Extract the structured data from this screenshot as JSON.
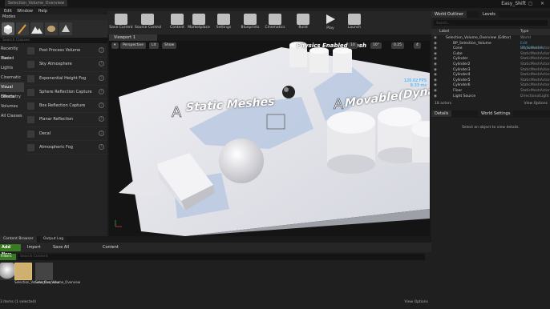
{
  "window": {
    "tab_title": "Selection_Volume_Overview",
    "project_name": "Easy_Shift",
    "controls": "– ◻ ✕"
  },
  "menu": [
    "Edit",
    "Window",
    "Help"
  ],
  "modes_tab": "Modes",
  "left_panel": {
    "search_placeholder": "Search Classes",
    "categories": [
      "Recently Placed",
      "Basic",
      "Lights",
      "Cinematic",
      "Visual Effects",
      "Geometry",
      "Volumes",
      "All Classes"
    ],
    "selected_category": "Visual Effects",
    "items": [
      "Post Process Volume",
      "Sky Atmosphere",
      "Exponential Height Fog",
      "Sphere Reflection Capture",
      "Box Reflection Capture",
      "Planar Reflection",
      "Decal",
      "Atmospheric Fog"
    ]
  },
  "toolbar": {
    "buttons": [
      "Save Current",
      "Source Control",
      "Content",
      "Marketplace",
      "Settings",
      "Blueprints",
      "Cinematics",
      "Build",
      "Play",
      "Launch"
    ]
  },
  "viewport": {
    "tab": "Viewport 1",
    "perspective": "Perspective",
    "lit": "Lit",
    "show": "Show",
    "grid": "10",
    "angle": "10°",
    "scale": "0.25",
    "camera": "4",
    "fps": "120.02 FPS",
    "ms": "8.33 ms",
    "labels": [
      "Static Meshes",
      "Movable(Dynamic)",
      "Physics Enabled Meshes"
    ],
    "label_display": [
      "Static Meshes",
      "Movable(Dynamic)",
      "Physics Enabled Mesh"
    ],
    "letter": "A"
  },
  "content_browser": {
    "tabs": [
      "Content Browser",
      "Output Log"
    ],
    "add_new": "Add New",
    "import": "Import",
    "save_all": "Save All",
    "path": "Content",
    "filters": "Filters",
    "search_placeholder": "Search Content",
    "assets": [
      {
        "name": "",
        "kind": "sphere"
      },
      {
        "name": "Selection_Volume_Overview",
        "kind": "map"
      },
      {
        "name": "Selection_Volume_Overview",
        "kind": "map-data"
      }
    ],
    "status": "3 items (1 selected)",
    "view_options": "View Options"
  },
  "outliner": {
    "tabs": [
      "World Outliner",
      "Levels"
    ],
    "search_placeholder": "Search...",
    "col_label": "Label",
    "col_type": "Type",
    "rows": [
      {
        "name": "Selection_Volume_Overview (Editor)",
        "type": "World",
        "indent": 0
      },
      {
        "name": "BP_Selection_Volume",
        "type": "Edit BP_Selection",
        "indent": 1,
        "link": true
      },
      {
        "name": "Cone",
        "type": "StaticMeshActor",
        "indent": 1
      },
      {
        "name": "Cube",
        "type": "StaticMeshActor",
        "indent": 1
      },
      {
        "name": "Cylinder",
        "type": "StaticMeshActor",
        "indent": 1
      },
      {
        "name": "Cylinder2",
        "type": "StaticMeshActor",
        "indent": 1
      },
      {
        "name": "Cylinder3",
        "type": "StaticMeshActor",
        "indent": 1
      },
      {
        "name": "Cylinder4",
        "type": "StaticMeshActor",
        "indent": 1
      },
      {
        "name": "Cylinder5",
        "type": "StaticMeshActor",
        "indent": 1
      },
      {
        "name": "Cylinder6",
        "type": "StaticMeshActor",
        "indent": 1
      },
      {
        "name": "Floor",
        "type": "StaticMeshActor",
        "indent": 1
      },
      {
        "name": "Light Source",
        "type": "DirectionalLight",
        "indent": 1
      }
    ],
    "count": "18 actors",
    "view_options": "View Options"
  },
  "details": {
    "tabs": [
      "Details",
      "World Settings"
    ],
    "message": "Select an object to view details."
  },
  "colors": {
    "accent_green": "#3a7a22",
    "link_blue": "#3a9be0",
    "fps_blue": "#22aaff"
  }
}
